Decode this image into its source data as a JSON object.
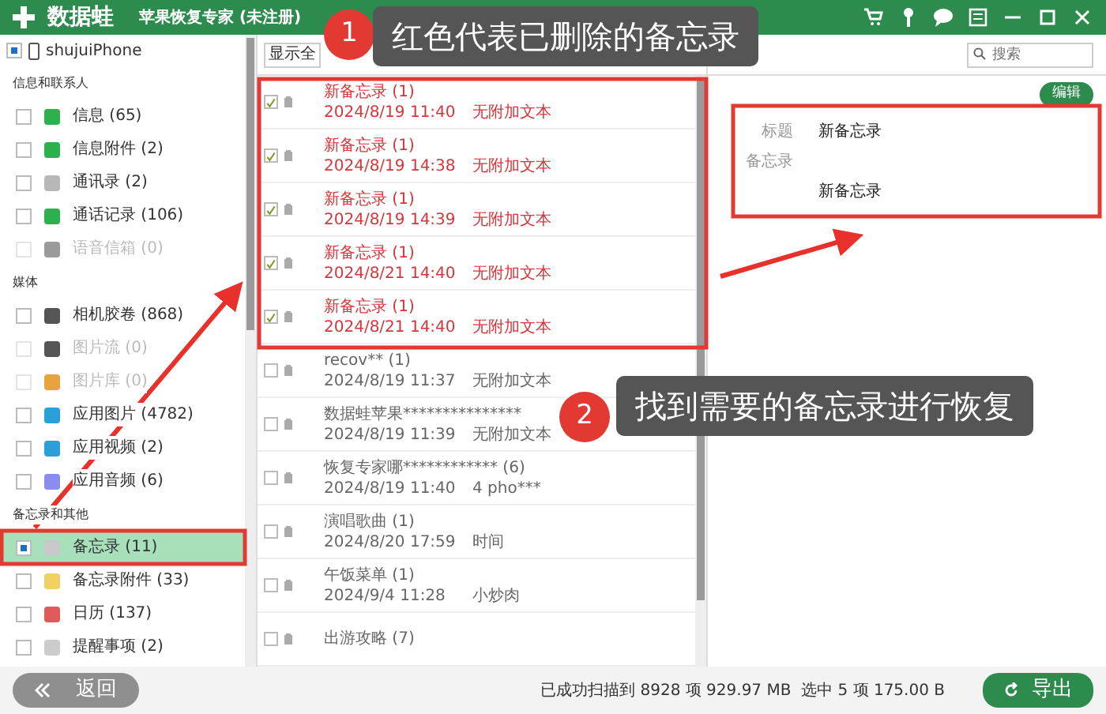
{
  "window": {
    "logo_text": "数据蛙",
    "title": "苹果恢复专家 (未注册)"
  },
  "sidebar": {
    "device": {
      "name": "shujuiPhone",
      "checked": true
    },
    "sections": [
      {
        "title": "信息和联系人",
        "items": [
          {
            "label": "信息 (65)",
            "checked": false,
            "disabled": false,
            "selected": false,
            "color": "#2bb24c"
          },
          {
            "label": "信息附件 (2)",
            "checked": false,
            "disabled": false,
            "selected": false,
            "color": "#2bb24c"
          },
          {
            "label": "通讯录 (2)",
            "checked": false,
            "disabled": false,
            "selected": false,
            "color": "#b8b8b8"
          },
          {
            "label": "通话记录 (106)",
            "checked": false,
            "disabled": false,
            "selected": false,
            "color": "#2bb24c"
          },
          {
            "label": "语音信箱 (0)",
            "checked": false,
            "disabled": true,
            "selected": false,
            "color": "#9a9a9a"
          }
        ]
      },
      {
        "title": "媒体",
        "items": [
          {
            "label": "相机胶卷 (868)",
            "checked": false,
            "disabled": false,
            "selected": false,
            "color": "#555555"
          },
          {
            "label": "图片流 (0)",
            "checked": false,
            "disabled": true,
            "selected": false,
            "color": "#555555"
          },
          {
            "label": "图片库 (0)",
            "checked": false,
            "disabled": true,
            "selected": false,
            "color": "#e8a33c"
          },
          {
            "label": "应用图片 (4782)",
            "checked": false,
            "disabled": false,
            "selected": false,
            "color": "#2a9fd8"
          },
          {
            "label": "应用视频 (2)",
            "checked": false,
            "disabled": false,
            "selected": false,
            "color": "#2a9fd8"
          },
          {
            "label": "应用音频 (6)",
            "checked": false,
            "disabled": false,
            "selected": false,
            "color": "#8c8cf0"
          }
        ]
      },
      {
        "title": "备忘录和其他",
        "items": [
          {
            "label": "备忘录 (11)",
            "checked": true,
            "disabled": false,
            "selected": true,
            "color": "#c8c8c8"
          },
          {
            "label": "备忘录附件 (33)",
            "checked": false,
            "disabled": false,
            "selected": false,
            "color": "#f0d060"
          },
          {
            "label": "日历 (137)",
            "checked": false,
            "disabled": false,
            "selected": false,
            "color": "#e05a5a"
          },
          {
            "label": "提醒事项 (2)",
            "checked": false,
            "disabled": false,
            "selected": false,
            "color": "#cccccc"
          }
        ]
      }
    ]
  },
  "list": {
    "filter": "显示全",
    "rows": [
      {
        "title": "新备忘录 (1)",
        "date": "2024/8/19 11:40",
        "preview": "无附加文本",
        "checked": true,
        "deleted": true
      },
      {
        "title": "新备忘录 (1)",
        "date": "2024/8/19 14:38",
        "preview": "无附加文本",
        "checked": true,
        "deleted": true
      },
      {
        "title": "新备忘录 (1)",
        "date": "2024/8/19 14:39",
        "preview": "无附加文本",
        "checked": true,
        "deleted": true
      },
      {
        "title": "新备忘录 (1)",
        "date": "2024/8/21 14:40",
        "preview": "无附加文本",
        "checked": true,
        "deleted": true
      },
      {
        "title": "新备忘录 (1)",
        "date": "2024/8/21 14:40",
        "preview": "无附加文本",
        "checked": true,
        "deleted": true
      },
      {
        "title": "recov** (1)",
        "date": "2024/8/19 11:37",
        "preview": "无附加文本",
        "checked": false,
        "deleted": false
      },
      {
        "title": "数据蛙苹果***************",
        "date": "2024/8/19 11:39",
        "preview": "无附加文本",
        "checked": false,
        "deleted": false
      },
      {
        "title": "恢复专家哪************ (6)",
        "date": "2024/8/19 11:40",
        "preview": "4 pho***",
        "checked": false,
        "deleted": false
      },
      {
        "title": "演唱歌曲 (1)",
        "date": "2024/8/20 17:59",
        "preview": "时间",
        "checked": false,
        "deleted": false
      },
      {
        "title": "午饭菜单 (1)",
        "date": "2024/9/4 11:28",
        "preview": "小炒肉",
        "checked": false,
        "deleted": false
      },
      {
        "title": "出游攻略 (7)",
        "checked": false,
        "deleted": false
      }
    ]
  },
  "detail": {
    "search": {
      "placeholder": "搜索"
    },
    "edit_button": "编辑",
    "fields": [
      {
        "label": "标题",
        "value": "新备忘录"
      },
      {
        "label": "备忘录"
      }
    ],
    "body": "新备忘录"
  },
  "footer": {
    "back_button": "返回",
    "status": "已成功扫描到 8928 项 929.97 MB  选中 5 项 175.00 B",
    "export_button": "导出"
  },
  "annotations": {
    "callouts": [
      {
        "number": "1",
        "text": "红色代表已删除的备忘录"
      },
      {
        "number": "2",
        "text": "找到需要的备忘录进行恢复"
      }
    ]
  }
}
